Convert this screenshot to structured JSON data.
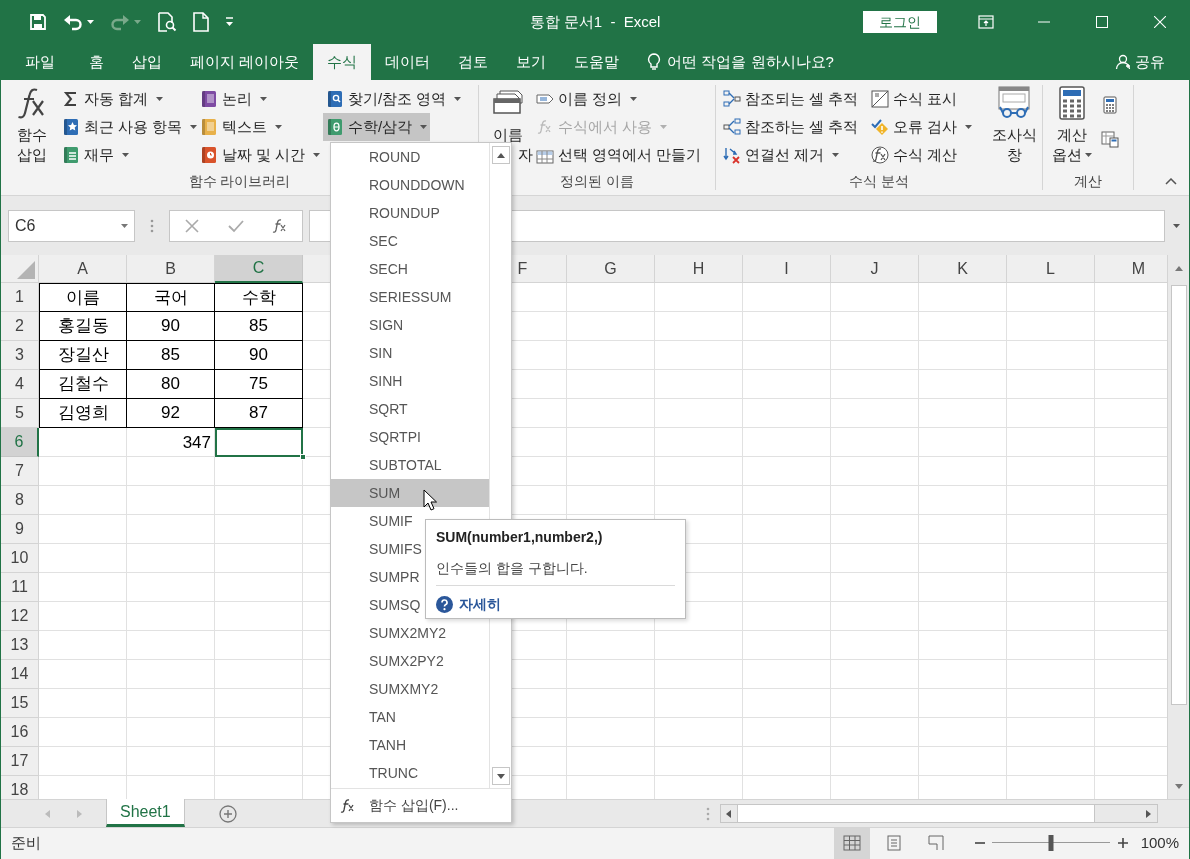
{
  "quick_access": [
    {
      "kind": "save",
      "disabled": false
    },
    {
      "kind": "undo",
      "disabled": false
    },
    {
      "kind": "redo",
      "disabled": true
    },
    {
      "kind": "print_preview",
      "disabled": false
    },
    {
      "kind": "new",
      "disabled": false
    },
    {
      "kind": "customize",
      "disabled": false
    }
  ],
  "window": {
    "title": "통합 문서1  -  Excel",
    "login": "로그인"
  },
  "tabs": [
    {
      "label": "파일",
      "selected": false
    },
    {
      "label": "홈",
      "selected": false
    },
    {
      "label": "삽입",
      "selected": false
    },
    {
      "label": "페이지 레이아웃",
      "selected": false
    },
    {
      "label": "수식",
      "selected": true
    },
    {
      "label": "데이터",
      "selected": false
    },
    {
      "label": "검토",
      "selected": false
    },
    {
      "label": "보기",
      "selected": false
    },
    {
      "label": "도움말",
      "selected": false
    }
  ],
  "tell_me": "어떤 작업을 원하시나요?",
  "share": "공유",
  "ribbon": {
    "groups": [
      {
        "label": "함수 라이브러리",
        "columns": [
          {
            "kind": "large",
            "lines": [
              "함수",
              "삽입"
            ],
            "dropdown": false
          },
          {
            "kind": "stack",
            "items": [
              {
                "label": "자동 합계",
                "dropdown": true,
                "pressed": false,
                "disabled": false
              },
              {
                "label": "최근 사용 항목",
                "dropdown": true,
                "pressed": false,
                "disabled": false
              },
              {
                "label": "재무",
                "dropdown": true,
                "pressed": false,
                "disabled": false
              }
            ]
          },
          {
            "kind": "stack",
            "items": [
              {
                "label": "논리",
                "dropdown": true,
                "pressed": false,
                "disabled": false
              },
              {
                "label": "텍스트",
                "dropdown": true,
                "pressed": false,
                "disabled": false
              },
              {
                "label": "날짜 및 시간",
                "dropdown": true,
                "pressed": false,
                "disabled": false
              }
            ]
          },
          {
            "kind": "stack",
            "items": [
              {
                "label": "찾기/참조 영역",
                "dropdown": true,
                "pressed": false,
                "disabled": false
              },
              {
                "label": "수학/삼각",
                "dropdown": true,
                "pressed": true,
                "disabled": false
              }
            ]
          }
        ]
      },
      {
        "label": "정의된 이름",
        "columns": [
          {
            "kind": "large",
            "lines": [
              "이름",
              "자"
            ],
            "dropdown": false
          },
          {
            "kind": "stack",
            "items": [
              {
                "label": "이름 정의",
                "dropdown": true,
                "pressed": false,
                "disabled": false
              },
              {
                "label": "수식에서 사용",
                "dropdown": true,
                "pressed": false,
                "disabled": true
              },
              {
                "label": "선택 영역에서 만들기",
                "dropdown": false,
                "pressed": false,
                "disabled": false
              }
            ]
          }
        ]
      },
      {
        "label": "수식 분석",
        "columns": [
          {
            "kind": "stack",
            "items": [
              {
                "label": "참조되는 셀 추적",
                "dropdown": false,
                "pressed": false,
                "disabled": false
              },
              {
                "label": "참조하는 셀 추적",
                "dropdown": false,
                "pressed": false,
                "disabled": false
              },
              {
                "label": "연결선 제거",
                "dropdown": true,
                "pressed": false,
                "disabled": false
              }
            ]
          },
          {
            "kind": "stack",
            "items": [
              {
                "label": "수식 표시",
                "dropdown": false,
                "pressed": false,
                "disabled": false
              },
              {
                "label": "오류 검사",
                "dropdown": true,
                "pressed": false,
                "disabled": false
              },
              {
                "label": "수식 계산",
                "dropdown": false,
                "pressed": false,
                "disabled": false
              }
            ]
          },
          {
            "kind": "large",
            "lines": [
              "조사식",
              "창"
            ],
            "dropdown": false
          }
        ]
      },
      {
        "label": "계산",
        "columns": [
          {
            "kind": "large",
            "lines": [
              "계산",
              "옵션"
            ],
            "dropdown": true
          },
          {
            "kind": "icons",
            "items": [
              {
                "disabled": false
              },
              {
                "disabled": false
              }
            ]
          }
        ]
      }
    ]
  },
  "formula_bar": {
    "name_box": "C6"
  },
  "sheet": {
    "columns": [
      {
        "label": "A",
        "selected": false
      },
      {
        "label": "B",
        "selected": false
      },
      {
        "label": "C",
        "selected": true
      },
      {
        "selected": false
      },
      {},
      {
        "label": "F",
        "selected": false
      },
      {
        "label": "G",
        "selected": false
      },
      {
        "label": "H",
        "selected": false
      },
      {
        "label": "I",
        "selected": false
      },
      {
        "label": "J",
        "selected": false
      },
      {
        "label": "K",
        "selected": false
      },
      {
        "label": "L",
        "selected": false
      },
      {
        "label": "M",
        "selected": false
      }
    ],
    "rows": [
      {
        "label": "1",
        "selected": false,
        "bordered": true,
        "cells": [
          {
            "text": "이름",
            "right_aligned": false,
            "selected": false
          },
          {
            "text": "국어",
            "right_aligned": false,
            "selected": false
          },
          {
            "text": "수학",
            "right_aligned": false,
            "selected": false
          }
        ]
      },
      {
        "label": "2",
        "selected": false,
        "bordered": true,
        "cells": [
          {
            "text": "홍길동",
            "right_aligned": false,
            "selected": false
          },
          {
            "text": "90",
            "right_aligned": false,
            "selected": false
          },
          {
            "text": "85",
            "right_aligned": false,
            "selected": false
          }
        ]
      },
      {
        "label": "3",
        "selected": false,
        "bordered": true,
        "cells": [
          {
            "text": "장길산",
            "right_aligned": false,
            "selected": false
          },
          {
            "text": "85",
            "right_aligned": false,
            "selected": false
          },
          {
            "text": "90",
            "right_aligned": false,
            "selected": false
          }
        ]
      },
      {
        "label": "4",
        "selected": false,
        "bordered": true,
        "cells": [
          {
            "text": "김철수",
            "right_aligned": false,
            "selected": false
          },
          {
            "text": "80",
            "right_aligned": false,
            "selected": false
          },
          {
            "text": "75",
            "right_aligned": false,
            "selected": false
          }
        ]
      },
      {
        "label": "5",
        "selected": false,
        "bordered": true,
        "cells": [
          {
            "text": "김영희",
            "right_aligned": false,
            "selected": false
          },
          {
            "text": "92",
            "right_aligned": false,
            "selected": false
          },
          {
            "text": "87",
            "right_aligned": false,
            "selected": false
          }
        ]
      },
      {
        "label": "6",
        "selected": true,
        "bordered": false,
        "cells": [
          {
            "selected": false
          },
          {
            "text": "347",
            "right_aligned": true,
            "selected": false
          },
          {
            "selected": true
          }
        ]
      },
      {
        "label": "7",
        "selected": false
      },
      {
        "label": "8",
        "selected": false
      },
      {
        "label": "9",
        "selected": false
      },
      {
        "label": "10",
        "selected": false
      },
      {
        "label": "11",
        "selected": false
      },
      {
        "label": "12",
        "selected": false
      },
      {
        "label": "13",
        "selected": false
      },
      {
        "label": "14",
        "selected": false
      },
      {
        "label": "15",
        "selected": false
      },
      {
        "label": "16",
        "selected": false
      },
      {
        "label": "17",
        "selected": false
      },
      {
        "label": "18",
        "selected": false
      }
    ]
  },
  "function_menu": {
    "items": [
      {
        "label": "ROUND",
        "selected": false
      },
      {
        "label": "ROUNDDOWN",
        "selected": false
      },
      {
        "label": "ROUNDUP",
        "selected": false
      },
      {
        "label": "SEC",
        "selected": false
      },
      {
        "label": "SECH",
        "selected": false
      },
      {
        "label": "SERIESSUM",
        "selected": false
      },
      {
        "label": "SIGN",
        "selected": false
      },
      {
        "label": "SIN",
        "selected": false
      },
      {
        "label": "SINH",
        "selected": false
      },
      {
        "label": "SQRT",
        "selected": false
      },
      {
        "label": "SQRTPI",
        "selected": false
      },
      {
        "label": "SUBTOTAL",
        "selected": false
      },
      {
        "label": "SUM",
        "selected": true
      },
      {
        "label": "SUMIF",
        "selected": false
      },
      {
        "label": "SUMIFS",
        "selected": false
      },
      {
        "label": "SUMPR",
        "selected": false
      },
      {
        "label": "SUMSQ",
        "selected": false
      },
      {
        "label": "SUMX2MY2",
        "selected": false
      },
      {
        "label": "SUMX2PY2",
        "selected": false
      },
      {
        "label": "SUMXMY2",
        "selected": false
      },
      {
        "label": "TAN",
        "selected": false
      },
      {
        "label": "TANH",
        "selected": false
      },
      {
        "label": "TRUNC",
        "selected": false
      }
    ],
    "footer": "함수 삽입(F)..."
  },
  "tooltip": {
    "title": "SUM(number1,number2,)",
    "description": "인수들의 합을 구합니다.",
    "link": "자세히"
  },
  "sheet_tabs": [
    {
      "label": "Sheet1",
      "selected": true
    }
  ],
  "status_bar": {
    "text": "준비",
    "views": [
      {
        "selected": true
      },
      {
        "selected": false
      },
      {
        "selected": false
      }
    ],
    "zoom": {
      "level": 0.5,
      "label": "100%"
    }
  }
}
